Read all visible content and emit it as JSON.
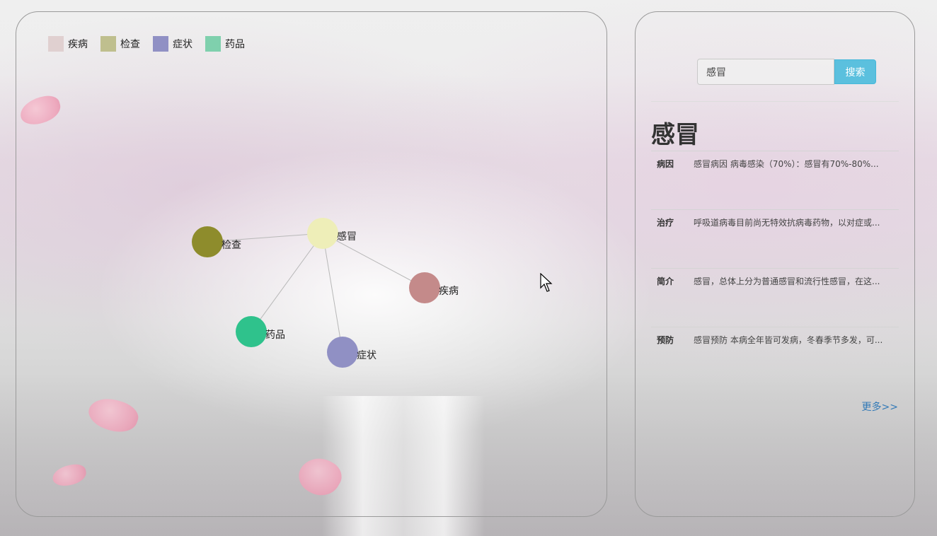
{
  "legend": [
    {
      "label": "疾病",
      "color": "#e0d0d0"
    },
    {
      "label": "检查",
      "color": "#bfbf8e"
    },
    {
      "label": "症状",
      "color": "#9090c4"
    },
    {
      "label": "药品",
      "color": "#7fd0ad"
    }
  ],
  "graph": {
    "nodes": [
      {
        "id": "center",
        "label": "感冒",
        "color": "#eeeeb8",
        "category": "疾病"
      },
      {
        "id": "check",
        "label": "检查",
        "color": "#8e8c2c",
        "category": "检查"
      },
      {
        "id": "disease",
        "label": "疾病",
        "color": "#c48a8a",
        "category": "疾病"
      },
      {
        "id": "drug",
        "label": "药品",
        "color": "#2fc28c",
        "category": "药品"
      },
      {
        "id": "symptom",
        "label": "症状",
        "color": "#9090c4",
        "category": "症状"
      }
    ],
    "edges": [
      [
        "center",
        "check"
      ],
      [
        "center",
        "disease"
      ],
      [
        "center",
        "drug"
      ],
      [
        "center",
        "symptom"
      ]
    ]
  },
  "search": {
    "value": "感冒",
    "button_label": "搜索"
  },
  "detail": {
    "title": "感冒",
    "rows": [
      {
        "key": "病因",
        "value": "感冒病因 病毒感染（70%）：感冒有70%-80%..."
      },
      {
        "key": "治疗",
        "value": "呼吸道病毒目前尚无特效抗病毒药物，以对症或..."
      },
      {
        "key": "简介",
        "value": "感冒，总体上分为普通感冒和流行性感冒，在这..."
      },
      {
        "key": "预防",
        "value": "感冒预防 本病全年皆可发病，冬春季节多发，可..."
      }
    ],
    "more_label": "更多>>"
  }
}
